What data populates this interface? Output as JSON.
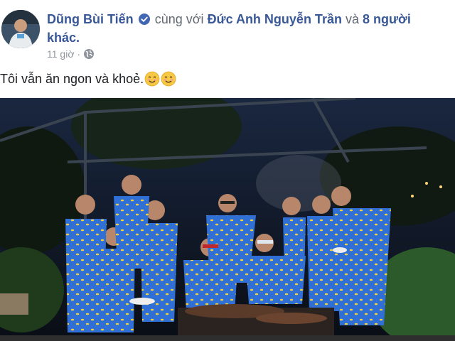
{
  "post": {
    "author_name": "Dũng Bùi Tiến",
    "with_text": "cùng với",
    "tagged_name": "Đức Anh Nguyễn Trần",
    "and_text": "và",
    "others_link": "8 người khác.",
    "timestamp": "11 giờ",
    "separator": "·",
    "privacy_icon": "globe-icon",
    "text": "Tôi vẫn ăn ngon và khoẻ.",
    "emojis": [
      "smiling-face-icon",
      "smiling-face-icon"
    ],
    "photo_alt": "group-photo"
  },
  "colors": {
    "link": "#385898",
    "meta": "#90949c",
    "verified": "#4267b2",
    "shirt": "#2f6fd6"
  }
}
